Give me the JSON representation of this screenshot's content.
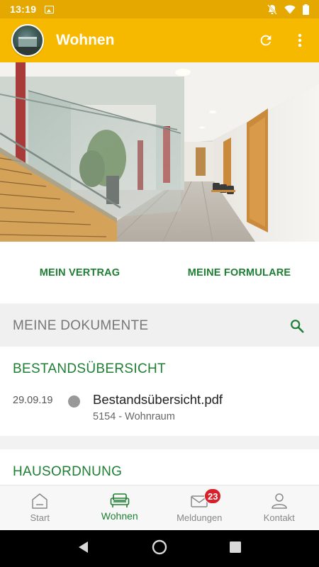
{
  "status_bar": {
    "time": "13:19",
    "icons": [
      "gallery-icon",
      "notifications-off-icon",
      "wifi-icon",
      "battery-icon"
    ]
  },
  "app_bar": {
    "title": "Wohnen",
    "avatar_icon": "building-avatar",
    "actions": [
      "refresh-icon",
      "more-vert-icon"
    ],
    "background_color": "#f7b900"
  },
  "hero": {
    "image_subject": "hallway-with-staircase-photo"
  },
  "actions": {
    "contract_label": "MEIN VERTRAG",
    "forms_label": "MEINE FORMULARE"
  },
  "documents": {
    "header_title": "MEINE DOKUMENTE",
    "search_icon": "search-icon",
    "sections": [
      {
        "title": "BESTANDSÜBERSICHT",
        "items": [
          {
            "date": "29.09.19",
            "name": "Bestandsübersicht.pdf",
            "subtitle": "5154 - Wohnraum"
          }
        ]
      },
      {
        "title": "HAUSORDNUNG",
        "items": []
      }
    ]
  },
  "bottom_nav": {
    "items": [
      {
        "label": "Start",
        "icon": "home-icon"
      },
      {
        "label": "Wohnen",
        "icon": "sofa-icon"
      },
      {
        "label": "Meldungen",
        "icon": "mail-icon",
        "badge": "23"
      },
      {
        "label": "Kontakt",
        "icon": "person-icon"
      }
    ],
    "active": "Wohnen"
  },
  "colors": {
    "accent_green": "#1e7e34",
    "brand_yellow": "#f7b900",
    "badge_red": "#d8202a"
  }
}
